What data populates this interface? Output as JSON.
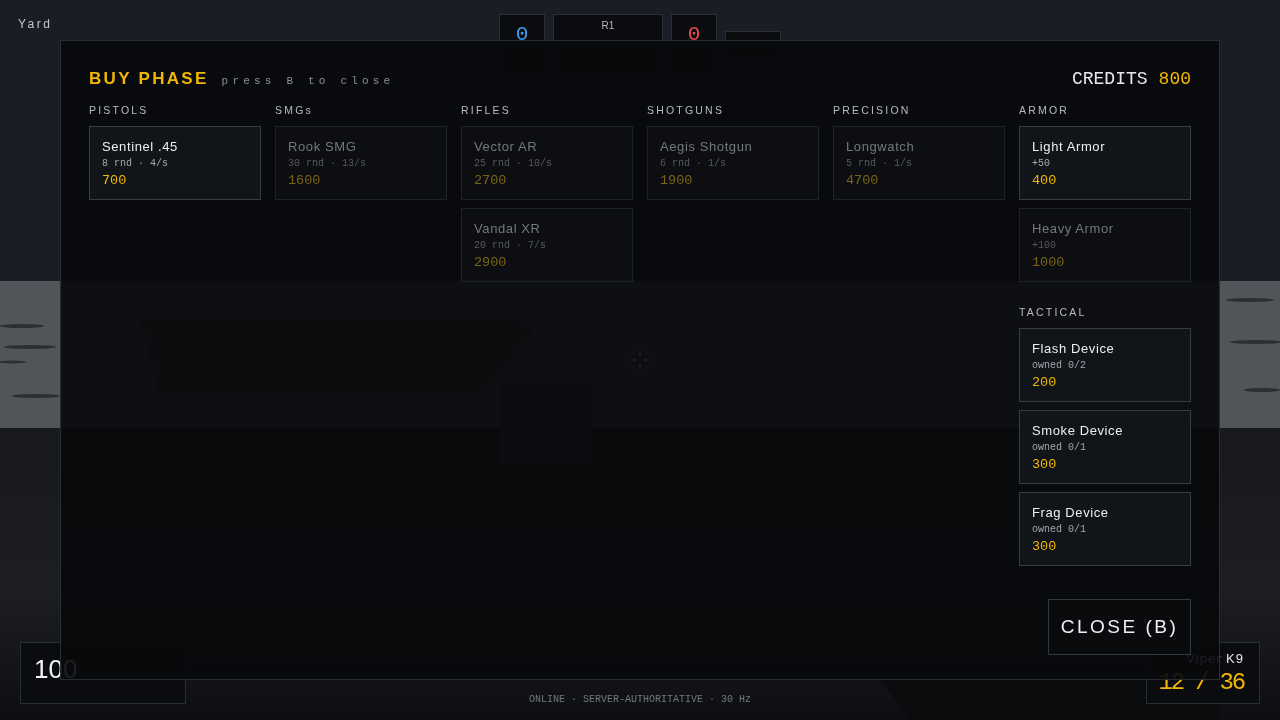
{
  "hud": {
    "location": "Yard",
    "teams": [
      {
        "score": "0",
        "color": "#3d9df2"
      },
      {
        "score": "0",
        "color": "#ef4a4a"
      }
    ],
    "round": "R1",
    "health": {
      "hp": "100"
    },
    "weapon": {
      "name": "Viper K9",
      "ammo": "12 / 36"
    },
    "status": "ONLINE · SERVER-AUTHORITATIVE · 30 Hz"
  },
  "buy_menu": {
    "title": "BUY PHASE",
    "hint": "press B to close",
    "credits_label": "CREDITS",
    "credits": "800",
    "columns": [
      {
        "groups": [
          {
            "heading": "PISTOLS",
            "items": [
              {
                "name": "Sentinel .45",
                "stats": "8 rnd · 4/s",
                "price": "700",
                "affordable": true
              }
            ]
          }
        ]
      },
      {
        "groups": [
          {
            "heading": "SMGs",
            "items": [
              {
                "name": "Rook SMG",
                "stats": "30 rnd · 13/s",
                "price": "1600",
                "affordable": false
              }
            ]
          }
        ]
      },
      {
        "groups": [
          {
            "heading": "RIFLES",
            "items": [
              {
                "name": "Vector AR",
                "stats": "25 rnd · 10/s",
                "price": "2700",
                "affordable": false
              },
              {
                "name": "Vandal XR",
                "stats": "20 rnd · 7/s",
                "price": "2900",
                "affordable": false
              }
            ]
          }
        ]
      },
      {
        "groups": [
          {
            "heading": "SHOTGUNS",
            "items": [
              {
                "name": "Aegis Shotgun",
                "stats": "6 rnd · 1/s",
                "price": "1900",
                "affordable": false
              }
            ]
          }
        ]
      },
      {
        "groups": [
          {
            "heading": "PRECISION",
            "items": [
              {
                "name": "Longwatch",
                "stats": "5 rnd · 1/s",
                "price": "4700",
                "affordable": false
              }
            ]
          }
        ]
      },
      {
        "groups": [
          {
            "heading": "ARMOR",
            "items": [
              {
                "name": "Light Armor",
                "stats": "+50",
                "price": "400",
                "affordable": true
              },
              {
                "name": "Heavy Armor",
                "stats": "+100",
                "price": "1000",
                "affordable": false
              }
            ]
          },
          {
            "heading": "TACTICAL",
            "items": [
              {
                "name": "Flash Device",
                "stats": "owned 0/2",
                "price": "200",
                "affordable": true
              },
              {
                "name": "Smoke Device",
                "stats": "owned 0/1",
                "price": "300",
                "affordable": true
              },
              {
                "name": "Frag Device",
                "stats": "owned 0/1",
                "price": "300",
                "affordable": true
              }
            ]
          }
        ]
      }
    ],
    "close_button": "CLOSE (B)"
  }
}
